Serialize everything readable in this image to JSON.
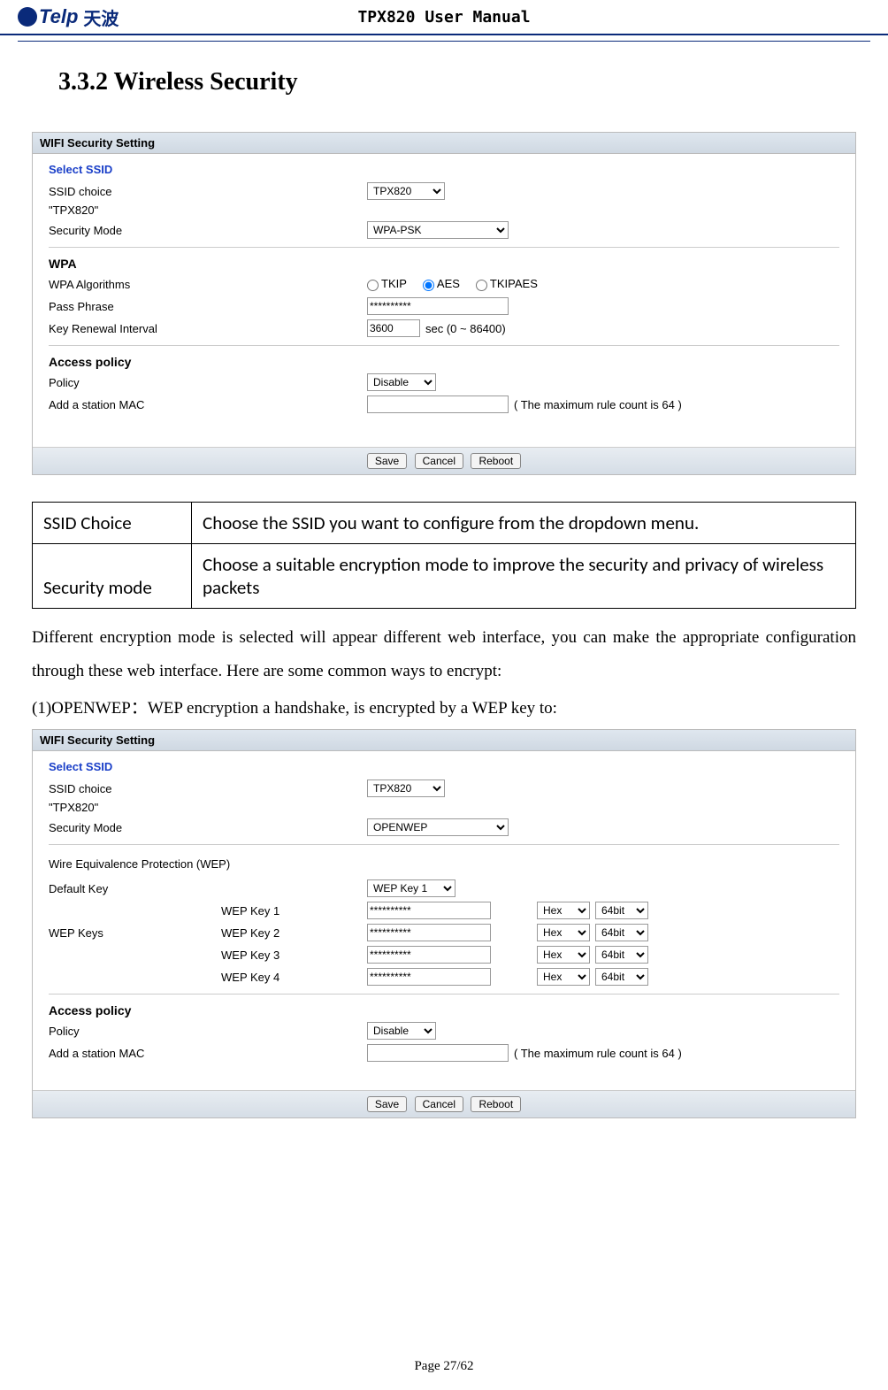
{
  "header": {
    "logo_text": "Telp",
    "logo_cn": "天波",
    "manual_title": "TPX820 User Manual"
  },
  "section_heading": "3.3.2 Wireless Security",
  "shot1": {
    "title": "WIFI Security Setting",
    "legend": "Select SSID",
    "ssid_choice_label": "SSID choice",
    "ssid_value": "TPX820",
    "ssid_quoted": "\"TPX820\"",
    "security_mode_label": "Security Mode",
    "security_mode_value": "WPA-PSK",
    "wpa_heading": "WPA",
    "wpa_algorithms_label": "WPA Algorithms",
    "algo_tkip": "TKIP",
    "algo_aes": "AES",
    "algo_tkipaes": "TKIPAES",
    "pass_phrase_label": "Pass Phrase",
    "pass_phrase_value": "**********",
    "key_renewal_label": "Key Renewal Interval",
    "key_renewal_value": "3600",
    "key_renewal_after": "sec   (0 ~ 86400)",
    "access_policy_heading": "Access policy",
    "policy_label": "Policy",
    "policy_value": "Disable",
    "add_mac_label": "Add a station MAC",
    "add_mac_after": "( The maximum rule count is 64 )",
    "btn_save": "Save",
    "btn_cancel": "Cancel",
    "btn_reboot": "Reboot"
  },
  "def_table": {
    "r1k": "SSID Choice",
    "r1v": "Choose  the  SSID  you  want  to  configure  from  the dropdown menu.",
    "r2k": "Security mode",
    "r2v": "Choose a suitable encryption mode to improve the security and privacy of wireless packets"
  },
  "para1": "Different encryption mode is selected will appear different web interface, you can make the appropriate configuration through these web interface. Here are some common ways to encrypt:",
  "para2": "(1)OPENWEP：WEP encryption a handshake, is encrypted by a WEP key to:",
  "shot2": {
    "title": "WIFI Security Setting",
    "legend": "Select SSID",
    "ssid_choice_label": "SSID choice",
    "ssid_value": "TPX820",
    "ssid_quoted": "\"TPX820\"",
    "security_mode_label": "Security Mode",
    "security_mode_value": "OPENWEP",
    "wep_section": "Wire Equivalence Protection (WEP)",
    "default_key_label": "Default Key",
    "default_key_value": "WEP Key 1",
    "wep_keys_label": "WEP Keys",
    "keys": [
      {
        "label": "WEP Key 1",
        "value": "**********",
        "enc": "Hex",
        "bits": "64bit"
      },
      {
        "label": "WEP Key 2",
        "value": "**********",
        "enc": "Hex",
        "bits": "64bit"
      },
      {
        "label": "WEP Key 3",
        "value": "**********",
        "enc": "Hex",
        "bits": "64bit"
      },
      {
        "label": "WEP Key 4",
        "value": "**********",
        "enc": "Hex",
        "bits": "64bit"
      }
    ],
    "access_policy_heading": "Access policy",
    "policy_label": "Policy",
    "policy_value": "Disable",
    "add_mac_label": "Add a station MAC",
    "add_mac_after": "( The maximum rule count is 64 )",
    "btn_save": "Save",
    "btn_cancel": "Cancel",
    "btn_reboot": "Reboot"
  },
  "footer": "Page 27/62"
}
